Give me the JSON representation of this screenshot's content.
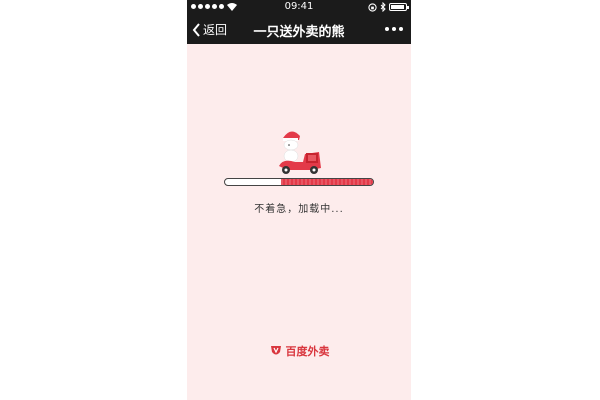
{
  "status_bar": {
    "time": "09:41"
  },
  "nav_bar": {
    "back_label": "返回",
    "title": "一只送外卖的熊"
  },
  "loading": {
    "progress": 0.62,
    "text": "不着急，加载中..."
  },
  "brand": {
    "name": "百度外卖"
  },
  "colors": {
    "status_bar_bg": "#1b1b1b",
    "page_bg": "#fdecec",
    "accent_red": "#e33a49"
  }
}
